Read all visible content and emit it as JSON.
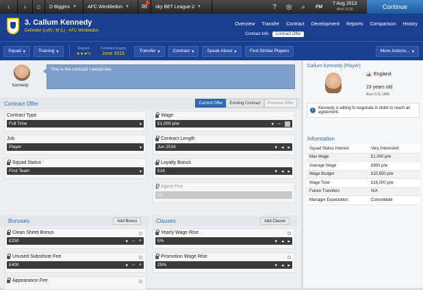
{
  "topbar": {
    "manager": "D Biggins",
    "club": "AFC Wimbledon",
    "league": "sky BET League 2",
    "notification_count": "1",
    "date": "7 Aug 2013",
    "day_time": "Wed 19:30",
    "continue_label": "Continue",
    "fm_label": "FM"
  },
  "header": {
    "player_name": "3. Callum Kennedy",
    "position_club": "Defender (Left) / M (L) - AFC Wimbledon",
    "nav": [
      "Overview",
      "Transfer",
      "Contract",
      "Development",
      "Reports",
      "Comparison",
      "History"
    ],
    "subtabs": [
      "Contract Info",
      "Contract Offer"
    ]
  },
  "toolbar": {
    "squad": "Squad",
    "training": "Training",
    "report_label": "Report",
    "report_stars": "★★★½",
    "expiry_label": "Contract Expiry",
    "expiry_value": "June 2015",
    "transfer": "Transfer",
    "contract": "Contract",
    "speak_about": "Speak About",
    "find_similar": "Find Similar Players",
    "more_actions": "More Actions..."
  },
  "speech": {
    "player_short": "Kennedy",
    "text": "This is the contract I would like."
  },
  "offer": {
    "title": "Contract Offer",
    "tabs": [
      "Current Offer",
      "Existing Contract",
      "Previous Offer"
    ],
    "contract_type_label": "Contract Type",
    "contract_type_value": "Full Time",
    "job_label": "Job",
    "job_value": "Player",
    "squad_status_label": "Squad Status",
    "squad_status_value": "First Team",
    "wage_label": "Wage",
    "wage_value": "£1,000 p/w",
    "length_label": "Contract Length",
    "length_value": "Jun 2016",
    "loyalty_label": "Loyalty Bonus",
    "loyalty_value": "£1K",
    "agent_label": "Agent Fee",
    "agent_value": "£0"
  },
  "bonuses": {
    "title": "Bonuses",
    "add_label": "Add Bonus",
    "items": [
      {
        "label": "Clean Sheet Bonus",
        "value": "£250"
      },
      {
        "label": "Unused Substitute Fee",
        "value": "£400"
      },
      {
        "label": "Appearance Fee",
        "value": ""
      }
    ]
  },
  "clauses": {
    "title": "Clauses",
    "add_label": "Add Clause",
    "items": [
      {
        "label": "Yearly Wage Rise",
        "value": "5%"
      },
      {
        "label": "Promotion Wage Rise",
        "value": "25%"
      }
    ]
  },
  "player_card": {
    "title": "Callum Kennedy (Player)",
    "nationality": "England",
    "age": "23 years old",
    "born": "Born 9.11.1989",
    "note": "Kennedy is willing to negotiate in order to reach an agreement."
  },
  "information": {
    "title": "Information",
    "rows": [
      {
        "k": "Squad Status Interest",
        "v": "Very Interested"
      },
      {
        "k": "Max Wage",
        "v": "£1,000 p/w"
      },
      {
        "k": "Average Wage",
        "v": "£800 p/w"
      },
      {
        "k": "Wage Budget",
        "v": "£20,500 p/w"
      },
      {
        "k": "Wage Total",
        "v": "£16,000 p/w"
      },
      {
        "k": "Future Transfers",
        "v": "N/A"
      },
      {
        "k": "Manager Expectation",
        "v": "Consolidate"
      }
    ]
  },
  "colors": {
    "header_blue": "#1b3f8f",
    "accent_blue": "#2e6ab0",
    "star_yellow": "#ffd600"
  }
}
